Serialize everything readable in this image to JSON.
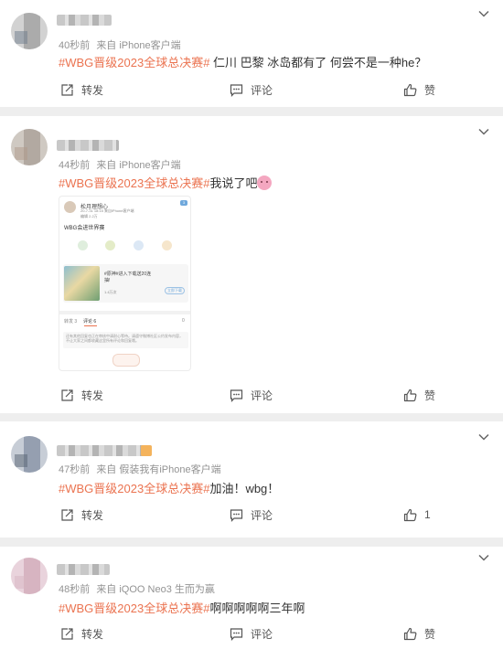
{
  "colors": {
    "accent": "#eb7350",
    "meta": "#939393",
    "background": "#eeeeee"
  },
  "actions": {
    "repost": "转发",
    "comment": "评论",
    "like": "赞"
  },
  "posts": [
    {
      "meta_time": "40秒前",
      "meta_source": "来自 iPhone客户端",
      "hashtag": "#WBG晋级2023全球总决赛#",
      "body": " 仁川 巴黎 冰岛都有了 何尝不是一种he？",
      "like_count": "赞"
    },
    {
      "meta_time": "44秒前",
      "meta_source": "来自 iPhone客户端",
      "hashtag": "#WBG晋级2023全球总决赛#",
      "body": "我说了吧",
      "emoji": "pig-face-emoji",
      "like_count": "赞",
      "image": {
        "user": "松月理想心",
        "source_line": "20-7-31 18:15 来自iPhone客户端",
        "sub_line": "编辑 2.2万",
        "tag": "3",
        "title": "WBG会进世界赛",
        "card_title": "#原神#进入下载送20连",
        "card_sub": "抽!",
        "card_meta": "1.4万次",
        "card_button": "立即下载",
        "tab_repost": "转发 3",
        "tab_comment": "评论 6",
        "tab_like": "0",
        "comment_placeholder": "还有其他回复也正在审核中请耐心等待。请遵守微博社区公约发布内容，不让大家之间都收藏这里所有评论和回复哦。"
      }
    },
    {
      "meta_time": "47秒前",
      "meta_source": "来自 假装我有iPhone客户端",
      "hashtag": "#WBG晋级2023全球总决赛#",
      "body": "加油！wbg！",
      "like_count": "1"
    },
    {
      "meta_time": "48秒前",
      "meta_source": "来自 iQOO Neo3 生而为赢",
      "hashtag": "#WBG晋级2023全球总决赛#",
      "body": "啊啊啊啊啊三年啊",
      "like_count": "赞"
    }
  ]
}
